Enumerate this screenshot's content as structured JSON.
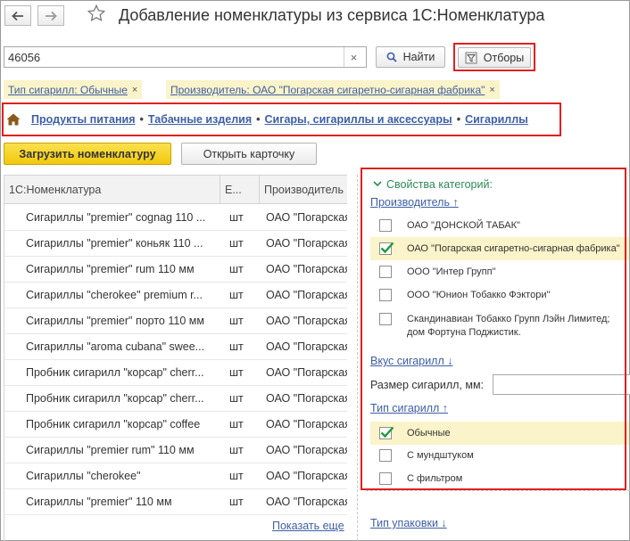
{
  "header": {
    "title": "Добавление номенклатуры из сервиса 1С:Номенклатура",
    "back_icon": "arrow-left-icon",
    "forward_icon": "arrow-right-icon",
    "favorite_icon": "star-icon"
  },
  "search": {
    "value": "46056",
    "clear_label": "×",
    "find_label": "Найти",
    "filters_label": "Отборы"
  },
  "chips": [
    {
      "label": "Тип сигарилл: Обычные",
      "remove": "×"
    },
    {
      "label": "Производитель: ОАО \"Погарская сигаретно-сигарная фабрика\"",
      "remove": "×"
    }
  ],
  "breadcrumb": {
    "items": [
      "Продукты питания",
      "Табачные изделия",
      "Сигары, сигариллы и аксессуары",
      "Сигариллы"
    ],
    "separator": "•"
  },
  "actions": {
    "load_label": "Загрузить номенклатуру",
    "open_card_label": "Открыть карточку"
  },
  "table": {
    "columns": [
      "1С:Номенклатура",
      "Е...",
      "Производитель"
    ],
    "rows": [
      [
        "Сигариллы \"premier\" cognag 110 ...",
        "шт",
        "ОАО \"Погарская"
      ],
      [
        "Сигариллы \"premier\" коньяк 110 ...",
        "шт",
        "ОАО \"Погарская"
      ],
      [
        "Сигариллы \"premier\" rum 110 мм",
        "шт",
        "ОАО \"Погарская"
      ],
      [
        "Сигариллы \"cherokee\" premium r...",
        "шт",
        "ОАО \"Погарская"
      ],
      [
        "Сигариллы \"premier\" порто 110 мм",
        "шт",
        "ОАО \"Погарская"
      ],
      [
        "Сигариллы \"aroma cubana\" swee...",
        "шт",
        "ОАО \"Погарская"
      ],
      [
        "Пробник сигарилл \"корсар\" cherr...",
        "шт",
        "ОАО \"Погарская"
      ],
      [
        "Пробник сигарилл \"корсар\" cherr...",
        "шт",
        "ОАО \"Погарская"
      ],
      [
        "Пробник сигарилл \"корсар\" coffee",
        "шт",
        "ОАО \"Погарская"
      ],
      [
        "Сигариллы \"premier rum\" 110 мм",
        "шт",
        "ОАО \"Погарская"
      ],
      [
        "Сигариллы \"cherokee\"",
        "шт",
        "ОАО \"Погарская"
      ],
      [
        "Сигариллы \"premier\" 110 мм",
        "шт",
        "ОАО \"Погарская"
      ]
    ],
    "show_more": "Показать еще"
  },
  "panel": {
    "title": "Свойства категорий:",
    "manufacturer_link": "Производитель ↑",
    "manufacturers": [
      {
        "label": "ОАО \"ДОНСКОЙ ТАБАК\"",
        "checked": false
      },
      {
        "label": "ОАО \"Погарская сигаретно-сигарная фабрика\"",
        "checked": true
      },
      {
        "label": "ООО \"Интер Групп\"",
        "checked": false
      },
      {
        "label": "ООО \"Юнион Тобакко Фэктори\"",
        "checked": false
      },
      {
        "label": "Скандинавиан Тобакко Групп Лэйн Лимитед; дом Фортуна Поджистик.",
        "checked": false
      }
    ],
    "taste_link": "Вкус сигарилл ↓",
    "size_label": "Размер сигарилл, мм:",
    "size_value": "",
    "type_link": "Тип сигарилл ↑",
    "types": [
      {
        "label": "Обычные",
        "checked": true
      },
      {
        "label": "С мундштуком",
        "checked": false
      },
      {
        "label": "С фильтром",
        "checked": false
      }
    ],
    "packaging_link": "Тип упаковки ↓"
  },
  "colors": {
    "accent_yellow": "#f5d21b",
    "highlight": "#fbf3c9",
    "link": "#3c5fa6",
    "section_green": "#2e8b57",
    "annotation_red": "#e02020",
    "check_green": "#1f9a3f"
  }
}
